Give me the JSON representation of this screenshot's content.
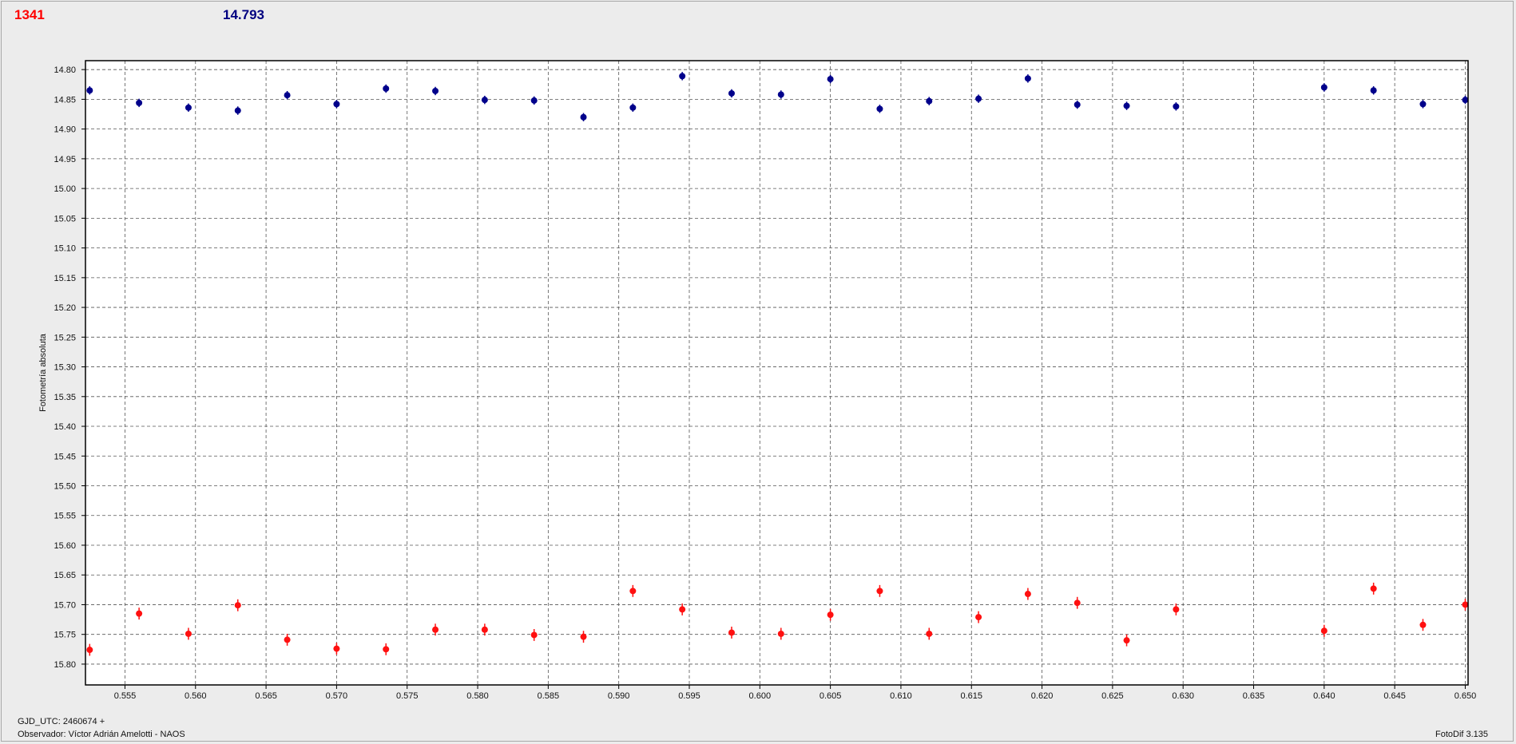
{
  "header": {
    "left_value": "1341",
    "left_color": "#ff0000",
    "right_value": "14.793",
    "right_color": "#000080"
  },
  "footer": {
    "gjd": "GJD_UTC: 2460674 +",
    "observer": "Observador: Víctor Adrián Amelotti - NAOS",
    "software": "FotoDif 3.135"
  },
  "chart_data": {
    "type": "scatter",
    "title": "",
    "xlabel": "",
    "ylabel": "Fotometría absoluta",
    "xlim": [
      0.5522,
      0.6502
    ],
    "ylim": [
      15.835,
      14.785
    ],
    "y_inverted": true,
    "grid": true,
    "x_ticks": [
      "0.555",
      "0.560",
      "0.565",
      "0.570",
      "0.575",
      "0.580",
      "0.585",
      "0.590",
      "0.595",
      "0.600",
      "0.605",
      "0.610",
      "0.615",
      "0.620",
      "0.625",
      "0.630",
      "0.635",
      "0.640",
      "0.645",
      "0.650"
    ],
    "y_ticks": [
      "14.80",
      "14.85",
      "14.90",
      "14.95",
      "15.00",
      "15.05",
      "15.10",
      "15.15",
      "15.20",
      "15.25",
      "15.30",
      "15.35",
      "15.40",
      "15.45",
      "15.50",
      "15.55",
      "15.60",
      "15.65",
      "15.70",
      "15.75",
      "15.80"
    ],
    "series": [
      {
        "color": "#00008b",
        "error": 0.007,
        "x": [
          0.5525,
          0.556,
          0.5595,
          0.563,
          0.5665,
          0.57,
          0.5735,
          0.577,
          0.5805,
          0.584,
          0.5875,
          0.591,
          0.5945,
          0.598,
          0.6015,
          0.605,
          0.6085,
          0.612,
          0.6155,
          0.619,
          0.6225,
          0.626,
          0.6295,
          0.64,
          0.6435,
          0.647,
          0.65
        ],
        "y": [
          14.835,
          14.856,
          14.864,
          14.869,
          14.843,
          14.858,
          14.832,
          14.836,
          14.851,
          14.852,
          14.88,
          14.864,
          14.811,
          14.84,
          14.842,
          14.816,
          14.866,
          14.853,
          14.849,
          14.815,
          14.859,
          14.861,
          14.862,
          14.83,
          14.835,
          14.858,
          14.851
        ]
      },
      {
        "color": "#ff1010",
        "error": 0.01,
        "x": [
          0.5525,
          0.556,
          0.5595,
          0.563,
          0.5665,
          0.57,
          0.5735,
          0.577,
          0.5805,
          0.584,
          0.5875,
          0.591,
          0.5945,
          0.598,
          0.6015,
          0.605,
          0.6085,
          0.612,
          0.6155,
          0.619,
          0.6225,
          0.626,
          0.6295,
          0.64,
          0.6435,
          0.647,
          0.65
        ],
        "y": [
          15.776,
          15.715,
          15.749,
          15.701,
          15.759,
          15.774,
          15.775,
          15.742,
          15.742,
          15.751,
          15.754,
          15.677,
          15.708,
          15.747,
          15.749,
          15.717,
          15.677,
          15.749,
          15.721,
          15.682,
          15.697,
          15.76,
          15.708,
          15.744,
          15.673,
          15.734,
          15.7
        ]
      }
    ]
  }
}
